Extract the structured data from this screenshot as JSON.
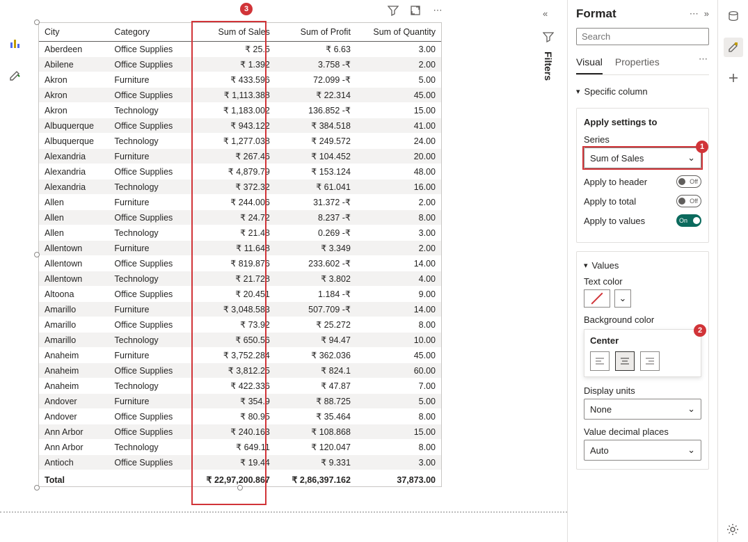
{
  "format_pane": {
    "title": "Format",
    "search_placeholder": "Search",
    "tabs": {
      "visual": "Visual",
      "properties": "Properties"
    },
    "section_specific_column": "Specific column",
    "apply_box": {
      "title": "Apply settings to",
      "series_label": "Series",
      "series_value": "Sum of Sales",
      "apply_to_header": "Apply to header",
      "apply_to_total": "Apply to total",
      "apply_to_values": "Apply to values",
      "header_state": "Off",
      "total_state": "Off",
      "values_state": "On"
    },
    "values_box": {
      "title": "Values",
      "text_color": "Text color",
      "background_color": "Background color",
      "alignment_label": "Center",
      "display_units_label": "Display units",
      "display_units_value": "None",
      "value_decimal_label": "Value decimal places",
      "value_decimal_value": "Auto"
    }
  },
  "filters_label": "Filters",
  "callouts": {
    "c1": "1",
    "c2": "2",
    "c3": "3"
  },
  "table": {
    "columns": [
      "City",
      "Category",
      "Sum of Sales",
      "Sum of Profit",
      "Sum of Quantity"
    ],
    "rows": [
      [
        "Aberdeen",
        "Office Supplies",
        "₹ 25.5",
        "₹ 6.63",
        "3.00"
      ],
      [
        "Abilene",
        "Office Supplies",
        "₹ 1.392",
        "3.758 -₹",
        "2.00"
      ],
      [
        "Akron",
        "Furniture",
        "₹ 433.596",
        "72.099 -₹",
        "5.00"
      ],
      [
        "Akron",
        "Office Supplies",
        "₹ 1,113.388",
        "₹ 22.314",
        "45.00"
      ],
      [
        "Akron",
        "Technology",
        "₹ 1,183.002",
        "136.852 -₹",
        "15.00"
      ],
      [
        "Albuquerque",
        "Office Supplies",
        "₹ 943.122",
        "₹ 384.518",
        "41.00"
      ],
      [
        "Albuquerque",
        "Technology",
        "₹ 1,277.038",
        "₹ 249.572",
        "24.00"
      ],
      [
        "Alexandria",
        "Furniture",
        "₹ 267.46",
        "₹ 104.452",
        "20.00"
      ],
      [
        "Alexandria",
        "Office Supplies",
        "₹ 4,879.79",
        "₹ 153.124",
        "48.00"
      ],
      [
        "Alexandria",
        "Technology",
        "₹ 372.32",
        "₹ 61.041",
        "16.00"
      ],
      [
        "Allen",
        "Furniture",
        "₹ 244.006",
        "31.372 -₹",
        "2.00"
      ],
      [
        "Allen",
        "Office Supplies",
        "₹ 24.72",
        "8.237 -₹",
        "8.00"
      ],
      [
        "Allen",
        "Technology",
        "₹ 21.48",
        "0.269 -₹",
        "3.00"
      ],
      [
        "Allentown",
        "Furniture",
        "₹ 11.648",
        "₹ 3.349",
        "2.00"
      ],
      [
        "Allentown",
        "Office Supplies",
        "₹ 819.876",
        "233.602 -₹",
        "14.00"
      ],
      [
        "Allentown",
        "Technology",
        "₹ 21.728",
        "₹ 3.802",
        "4.00"
      ],
      [
        "Altoona",
        "Office Supplies",
        "₹ 20.451",
        "1.184 -₹",
        "9.00"
      ],
      [
        "Amarillo",
        "Furniture",
        "₹ 3,048.583",
        "507.709 -₹",
        "14.00"
      ],
      [
        "Amarillo",
        "Office Supplies",
        "₹ 73.92",
        "₹ 25.272",
        "8.00"
      ],
      [
        "Amarillo",
        "Technology",
        "₹ 650.56",
        "₹ 94.47",
        "10.00"
      ],
      [
        "Anaheim",
        "Furniture",
        "₹ 3,752.284",
        "₹ 362.036",
        "45.00"
      ],
      [
        "Anaheim",
        "Office Supplies",
        "₹ 3,812.25",
        "₹ 824.1",
        "60.00"
      ],
      [
        "Anaheim",
        "Technology",
        "₹ 422.336",
        "₹ 47.87",
        "7.00"
      ],
      [
        "Andover",
        "Furniture",
        "₹ 354.9",
        "₹ 88.725",
        "5.00"
      ],
      [
        "Andover",
        "Office Supplies",
        "₹ 80.95",
        "₹ 35.464",
        "8.00"
      ],
      [
        "Ann Arbor",
        "Office Supplies",
        "₹ 240.163",
        "₹ 108.868",
        "15.00"
      ],
      [
        "Ann Arbor",
        "Technology",
        "₹ 649.11",
        "₹ 120.047",
        "8.00"
      ],
      [
        "Antioch",
        "Office Supplies",
        "₹ 19.44",
        "₹ 9.331",
        "3.00"
      ]
    ],
    "total": [
      "Total",
      "",
      "₹ 22,97,200.867",
      "₹ 2,86,397.162",
      "37,873.00"
    ]
  }
}
